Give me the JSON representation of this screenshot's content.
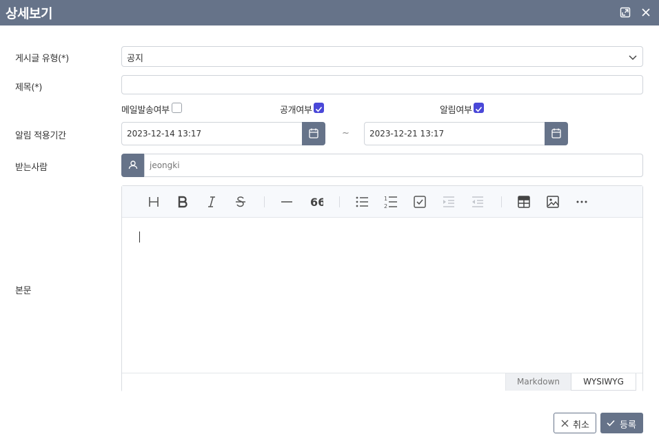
{
  "window": {
    "title": "상세보기",
    "icons": [
      "expand-icon",
      "close-icon"
    ]
  },
  "form": {
    "post_type": {
      "label": "게시글 유형(*)",
      "value": "공지"
    },
    "subject": {
      "label": "제목(*)",
      "value": "",
      "placeholder": ""
    },
    "checkboxes": [
      {
        "label": "메일발송여부",
        "checked": false
      },
      {
        "label": "공개여부",
        "checked": true
      },
      {
        "label": "알림여부",
        "checked": true
      }
    ],
    "alert_period": {
      "label": "알림 적용기간",
      "start": "2023-12-14 13:17",
      "separator": "~",
      "end": "2023-12-21 13:17"
    },
    "recipient": {
      "label": "받는사람",
      "placeholder": "jeongki"
    },
    "body": {
      "label": "본문"
    }
  },
  "editor": {
    "toolbar": [
      "heading",
      "bold",
      "italic",
      "strike",
      "hr",
      "quote",
      "bullet-list",
      "ordered-list",
      "task-list",
      "indent",
      "outdent",
      "table",
      "image",
      "more"
    ],
    "modes": {
      "markdown": "Markdown",
      "wysiwyg": "WYSIWYG",
      "active": "WYSIWYG"
    }
  },
  "footer": {
    "cancel_label": "취소",
    "submit_label": "등록"
  },
  "colors": {
    "titlebar": "#667389",
    "accent": "#4a48d8"
  }
}
